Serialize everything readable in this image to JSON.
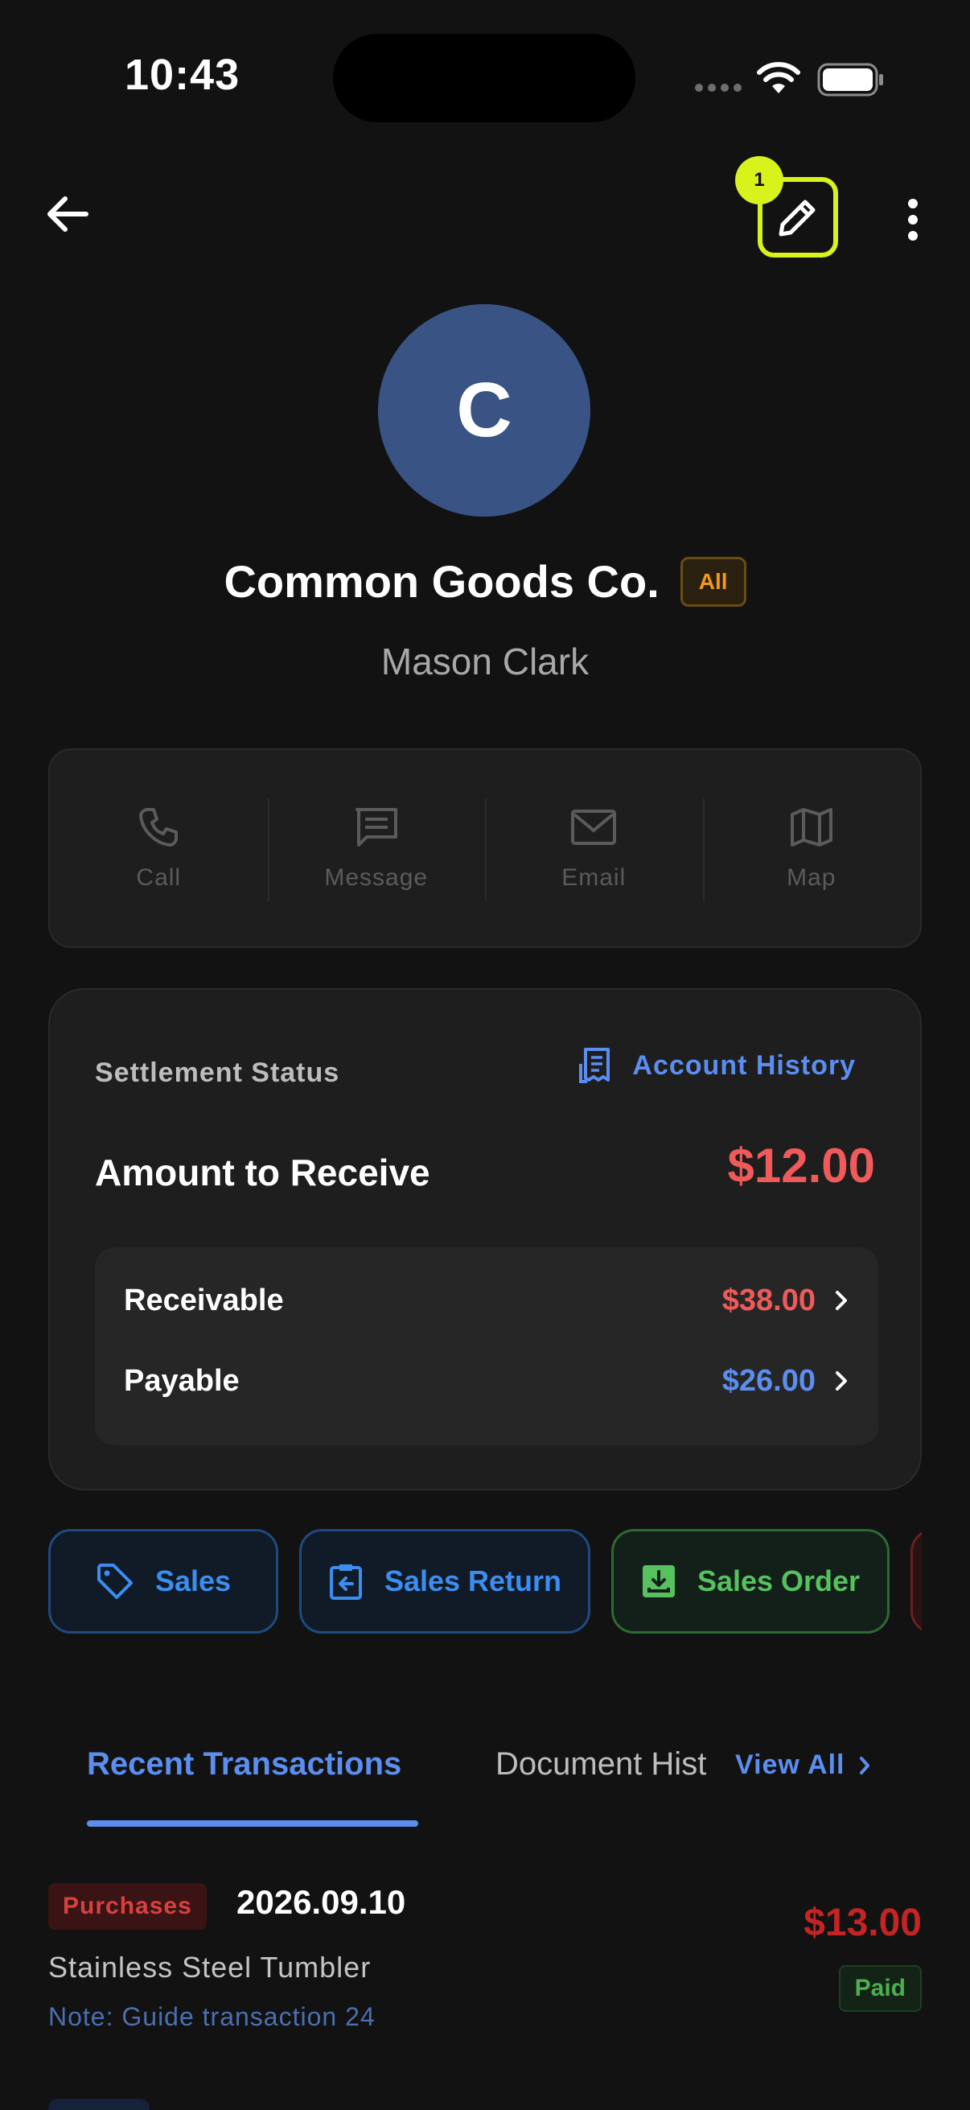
{
  "status_bar": {
    "time": "10:43"
  },
  "header": {
    "edit_badge": "1"
  },
  "profile": {
    "avatar_letter": "C",
    "company_name": "Common Goods Co.",
    "tag": "All",
    "contact_name": "Mason Clark"
  },
  "actions": [
    {
      "label": "Call",
      "icon": "phone-icon"
    },
    {
      "label": "Message",
      "icon": "message-icon"
    },
    {
      "label": "Email",
      "icon": "mail-icon"
    },
    {
      "label": "Map",
      "icon": "map-icon"
    }
  ],
  "settlement": {
    "title": "Settlement Status",
    "account_history_label": "Account History",
    "amount_label": "Amount to Receive",
    "amount_value": "$12.00",
    "receivable_label": "Receivable",
    "receivable_value": "$38.00",
    "payable_label": "Payable",
    "payable_value": "$26.00"
  },
  "doc_buttons": [
    {
      "label": "Sales",
      "icon": "tag-icon"
    },
    {
      "label": "Sales Return",
      "icon": "return-icon"
    },
    {
      "label": "Sales Order",
      "icon": "inbox-download-icon"
    }
  ],
  "tabs": {
    "active": "Recent Transactions",
    "inactive": "Document History",
    "view_all": "View All"
  },
  "transactions": [
    {
      "type": "Purchases",
      "date": "2026.09.10",
      "item": "Stainless Steel Tumbler",
      "note": "Note: Guide transaction 24",
      "amount": "$13.00",
      "status": "Paid"
    }
  ],
  "colors": {
    "accent_blue": "#5c8ef0",
    "negative_red": "#f05a5a",
    "highlight": "#d8f21c",
    "avatar_bg": "#395484",
    "tag_orange": "#f09a1c"
  }
}
